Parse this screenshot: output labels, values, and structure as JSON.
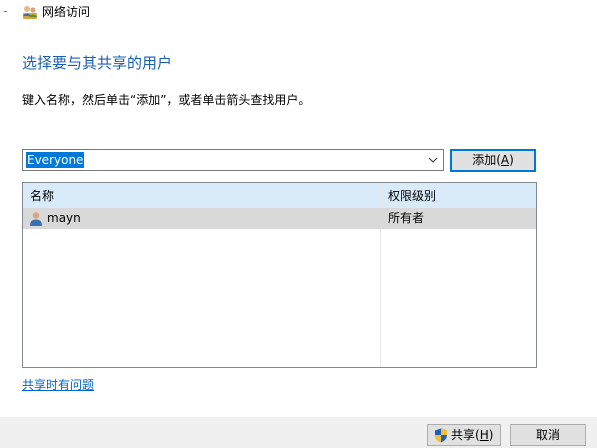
{
  "window": {
    "title": "网络访问",
    "icon": "network-share-users-icon"
  },
  "heading": "选择要与其共享的用户",
  "instruction": "键入名称，然后单击“添加”，或者单击箭头查找用户。",
  "user_combo": {
    "value": "Everyone",
    "dropdown_icon": "chevron-down-icon"
  },
  "add_button": {
    "label": "添加(",
    "mnemonic": "A",
    "suffix": ")"
  },
  "table": {
    "columns": [
      "名称",
      "权限级别"
    ],
    "rows": [
      {
        "name": "mayn",
        "permission": "所有者",
        "icon": "user-icon",
        "selected": true
      }
    ]
  },
  "help_link": "共享时有问题",
  "share_button": {
    "label": "共享(",
    "mnemonic": "H",
    "suffix": ")",
    "icon": "uac-shield-icon"
  },
  "cancel_button": {
    "label": "取消"
  },
  "colors": {
    "heading": "#1b5fb3",
    "accent": "#0078d7",
    "link": "#0066cc",
    "header_bg": "#d9ebf9",
    "row_selected": "#d9d9d9"
  }
}
